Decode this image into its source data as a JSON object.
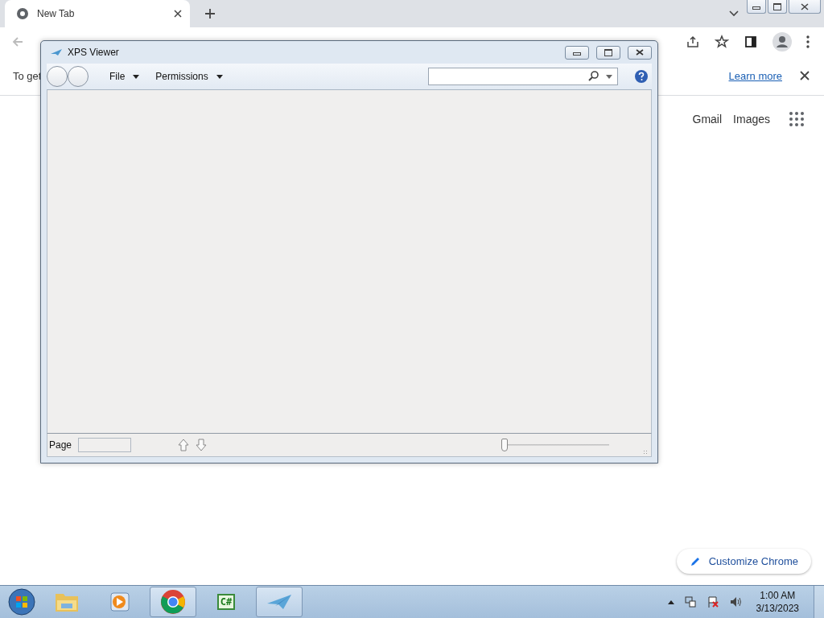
{
  "browser": {
    "tabs": [
      {
        "title": "New Tab",
        "selected": true
      }
    ],
    "infobar": {
      "text": "To get",
      "link": "Learn more"
    },
    "links": [
      "Gmail",
      "Images"
    ],
    "customize_button": "Customize Chrome"
  },
  "xps_window": {
    "title": "XPS Viewer",
    "menus": [
      "File",
      "Permissions"
    ],
    "page_label": "Page",
    "zoom": {
      "level": 0.0
    }
  },
  "taskbar": {
    "apps": [
      {
        "kind": "folder",
        "selected": false
      },
      {
        "kind": "media",
        "selected": false
      },
      {
        "kind": "chrome",
        "selected": true
      },
      {
        "kind": "code",
        "label": "C#",
        "selected": false
      },
      {
        "kind": "xps",
        "selected": true
      }
    ],
    "clock": {
      "time": "1:00 AM",
      "date": "3/13/2023"
    }
  }
}
